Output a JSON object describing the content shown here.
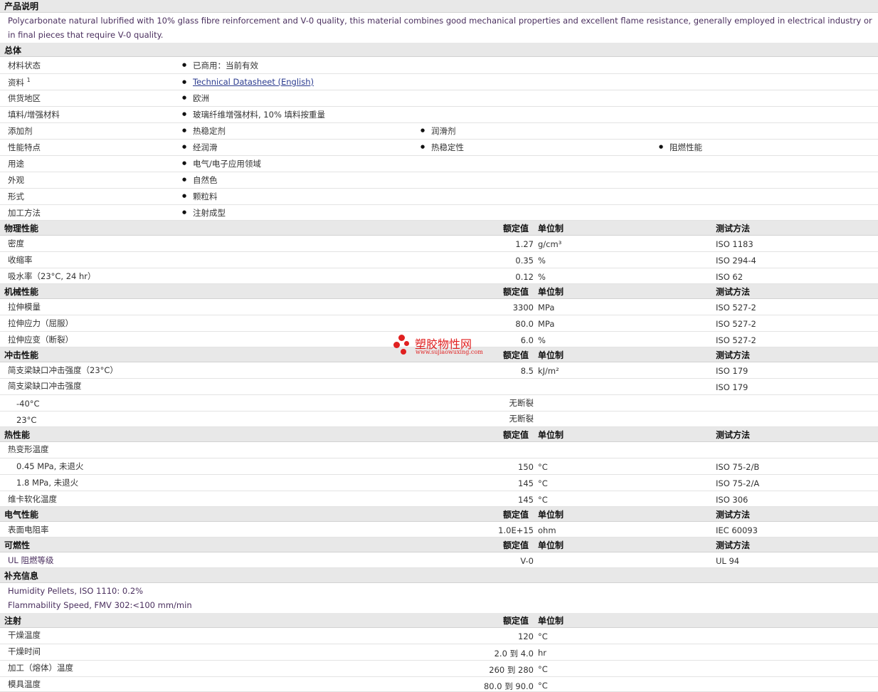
{
  "product": {
    "title": "产品说明",
    "description": "Polycarbonate natural lubrified with 10% glass fibre reinforcement and V-0 quality, this material combines good mechanical properties and excellent flame resistance, generally employed in electrical industry or in final pieces that require V-0 quality."
  },
  "general": {
    "title": "总体",
    "rows": [
      {
        "label": "材料状态",
        "items": [
          "已商用：当前有效"
        ]
      },
      {
        "label": "资料",
        "sup": "1",
        "items": [
          "Technical Datasheet (English)"
        ]
      },
      {
        "label": "供货地区",
        "items": [
          "欧洲"
        ]
      },
      {
        "label": "填料/增强材料",
        "items": [
          "玻璃纤维增强材料, 10% 填料按重量"
        ]
      },
      {
        "label": "添加剂",
        "items": [
          "热稳定剂",
          "润滑剂"
        ]
      },
      {
        "label": "性能特点",
        "items": [
          "经润滑",
          "热稳定性",
          "阻燃性能"
        ]
      },
      {
        "label": "用途",
        "items": [
          "电气/电子应用领域"
        ]
      },
      {
        "label": "外观",
        "items": [
          "自然色"
        ]
      },
      {
        "label": "形式",
        "items": [
          "颗粒料"
        ]
      },
      {
        "label": "加工方法",
        "items": [
          "注射成型"
        ]
      }
    ]
  },
  "headers": {
    "value": "额定值",
    "unit": "单位制",
    "method": "测试方法"
  },
  "physical": {
    "title": "物理性能",
    "rows": [
      {
        "label": "密度",
        "value": "1.27",
        "unit": "g/cm³",
        "method": "ISO 1183"
      },
      {
        "label": "收缩率",
        "value": "0.35",
        "unit": "%",
        "method": "ISO 294-4"
      },
      {
        "label": "吸水率（23°C, 24 hr）",
        "value": "0.12",
        "unit": "%",
        "method": "ISO 62"
      }
    ]
  },
  "mechanical": {
    "title": "机械性能",
    "rows": [
      {
        "label": "拉伸模量",
        "value": "3300",
        "unit": "MPa",
        "method": "ISO 527-2"
      },
      {
        "label": "拉伸应力（屈服）",
        "value": "80.0",
        "unit": "MPa",
        "method": "ISO 527-2"
      },
      {
        "label": "拉伸应变（断裂）",
        "value": "6.0",
        "unit": "%",
        "method": "ISO 527-2"
      }
    ]
  },
  "impact": {
    "title": "冲击性能",
    "rows": [
      {
        "label": "简支梁缺口冲击强度（23°C）",
        "value": "8.5",
        "unit": "kJ/m²",
        "method": "ISO 179"
      },
      {
        "label": "简支梁缺口冲击强度",
        "value": "",
        "unit": "",
        "method": "ISO 179"
      },
      {
        "label": "-40°C",
        "value": "无断裂",
        "unit": "",
        "method": ""
      },
      {
        "label": "23°C",
        "value": "无断裂",
        "unit": "",
        "method": ""
      }
    ]
  },
  "thermal": {
    "title": "热性能",
    "rows": [
      {
        "label": "热变形温度",
        "value": "",
        "unit": "",
        "method": ""
      },
      {
        "label": "0.45 MPa, 未退火",
        "value": "150",
        "unit": "°C",
        "method": "ISO 75-2/B"
      },
      {
        "label": "1.8 MPa, 未退火",
        "value": "145",
        "unit": "°C",
        "method": "ISO 75-2/A"
      },
      {
        "label": "维卡软化温度",
        "value": "145",
        "unit": "°C",
        "method": "ISO 306"
      }
    ]
  },
  "electrical": {
    "title": "电气性能",
    "rows": [
      {
        "label": "表面电阻率",
        "value": "1.0E+15",
        "unit": "ohm",
        "method": "IEC 60093"
      }
    ]
  },
  "flammability": {
    "title": "可燃性",
    "rows": [
      {
        "label": "UL 阻燃等级",
        "value": "V-0",
        "unit": "",
        "method": "UL 94"
      }
    ]
  },
  "supplement": {
    "title": "补充信息",
    "lines": [
      "Humidity Pellets, ISO 1110: 0.2%",
      "Flammability Speed, FMV 302:<100 mm/min"
    ]
  },
  "injection": {
    "title": "注射",
    "rows": [
      {
        "label": "干燥温度",
        "value": "120",
        "unit": "°C"
      },
      {
        "label": "干燥时间",
        "value": "2.0 到  4.0",
        "unit": "hr"
      },
      {
        "label": "加工（熔体）温度",
        "value": "260 到  280",
        "unit": "°C"
      },
      {
        "label": "模具温度",
        "value": "80.0 到  90.0",
        "unit": "°C"
      }
    ]
  },
  "watermark": {
    "title": "塑胶物性网",
    "url": "www.sujiaowuxing.com"
  }
}
